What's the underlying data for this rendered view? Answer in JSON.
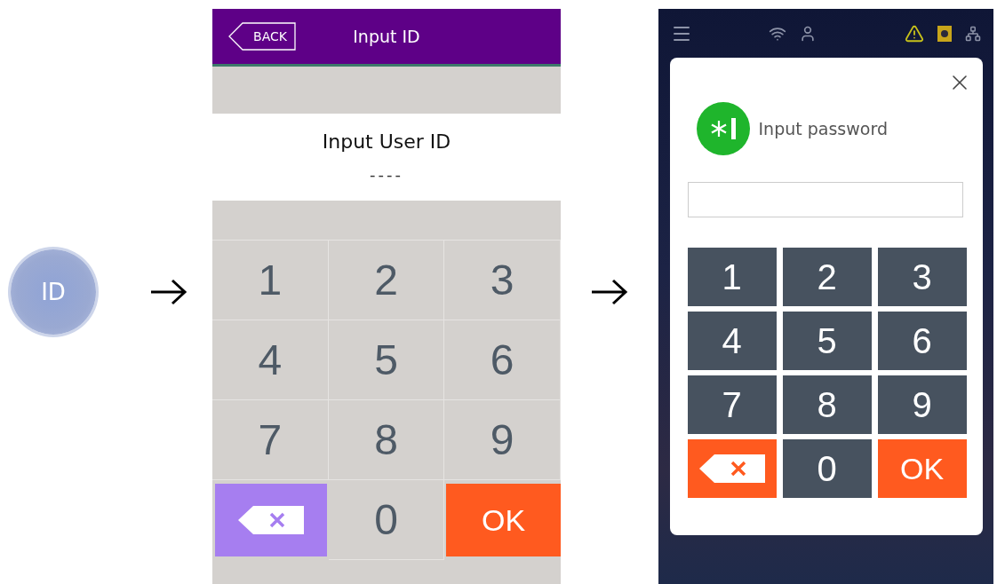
{
  "id_button": {
    "label": "ID"
  },
  "id_screen": {
    "back": "BACK",
    "title": "Input ID",
    "prompt": "Input User ID",
    "value": "----",
    "keys": [
      {
        "kind": "digit",
        "label": "1"
      },
      {
        "kind": "digit",
        "label": "2"
      },
      {
        "kind": "digit",
        "label": "3"
      },
      {
        "kind": "digit",
        "label": "4"
      },
      {
        "kind": "digit",
        "label": "5"
      },
      {
        "kind": "digit",
        "label": "6"
      },
      {
        "kind": "digit",
        "label": "7"
      },
      {
        "kind": "digit",
        "label": "8"
      },
      {
        "kind": "digit",
        "label": "9"
      },
      {
        "kind": "delete"
      },
      {
        "kind": "digit",
        "label": "0"
      },
      {
        "kind": "ok",
        "label": "OK"
      }
    ]
  },
  "password_screen": {
    "title": "Input password",
    "keys": [
      {
        "kind": "digit",
        "label": "1"
      },
      {
        "kind": "digit",
        "label": "2"
      },
      {
        "kind": "digit",
        "label": "3"
      },
      {
        "kind": "digit",
        "label": "4"
      },
      {
        "kind": "digit",
        "label": "5"
      },
      {
        "kind": "digit",
        "label": "6"
      },
      {
        "kind": "digit",
        "label": "7"
      },
      {
        "kind": "digit",
        "label": "8"
      },
      {
        "kind": "digit",
        "label": "9"
      },
      {
        "kind": "delete"
      },
      {
        "kind": "digit",
        "label": "0"
      },
      {
        "kind": "ok",
        "label": "OK"
      }
    ]
  }
}
